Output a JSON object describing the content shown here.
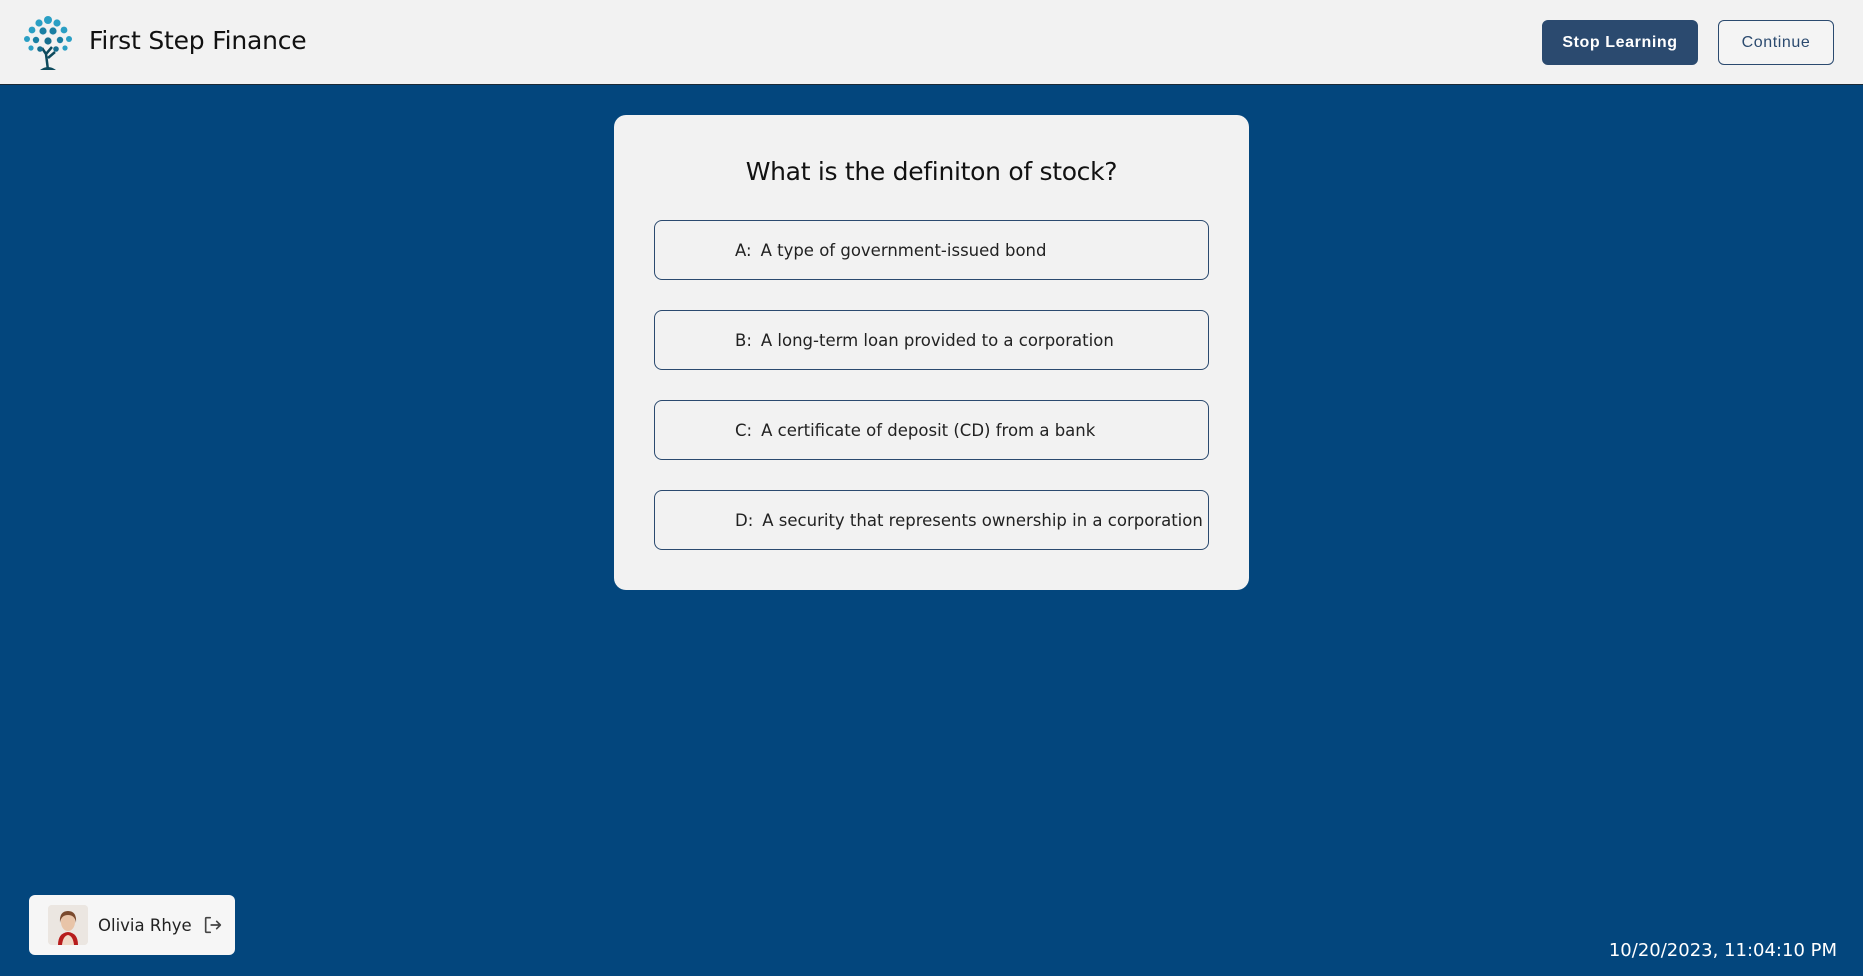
{
  "header": {
    "brand": "First Step Finance",
    "logo_icon": "tree-logo-icon",
    "stop_label": "Stop Learning",
    "continue_label": "Continue"
  },
  "quiz": {
    "question": "What is the definiton of stock?",
    "options": [
      {
        "letter": "A:",
        "text": "A type of government-issued bond"
      },
      {
        "letter": "B:",
        "text": "A long-term loan provided to a corporation"
      },
      {
        "letter": "C:",
        "text": "A certificate of deposit (CD) from a bank"
      },
      {
        "letter": "D:",
        "text": "A security that represents ownership in a corporation"
      }
    ]
  },
  "user": {
    "name": "Olivia Rhye",
    "logout_icon": "logout-icon"
  },
  "timestamp": "10/20/2023, 11:04:10 PM",
  "colors": {
    "background": "#03467d",
    "header_bg": "#f2f2f2",
    "primary_button": "#2b4a6f",
    "logo_teal": "#2a8fb0"
  }
}
